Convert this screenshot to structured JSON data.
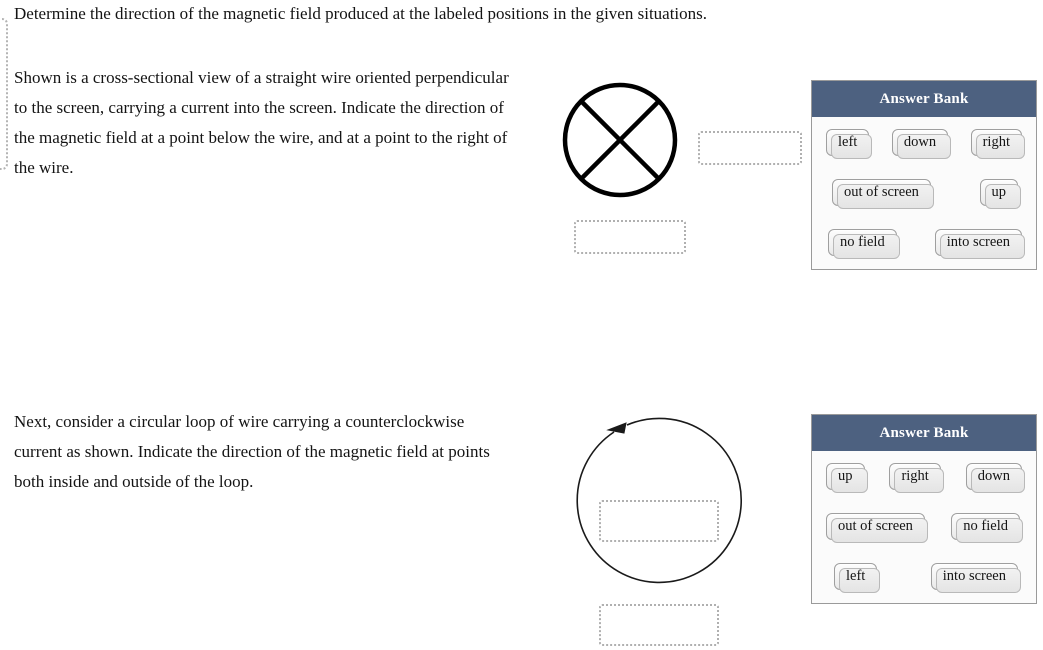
{
  "instruction": "Determine the direction of the magnetic field produced at the labeled positions in the given situations.",
  "parts": [
    {
      "id": "part-1",
      "stem": "Shown is a cross-sectional view of a straight wire oriented perpendicular to the screen, carrying a current into the screen. Indicate the direction of the magnetic field at a point below the wire, and at a point to the right of the wire.",
      "figure": {
        "type": "wire-cross-section",
        "description": "circle with an X inside indicating current into the screen",
        "dropzones": [
          {
            "name": "dropzone-right-of-wire",
            "value": ""
          },
          {
            "name": "dropzone-below-wire",
            "value": ""
          }
        ]
      },
      "answer_bank": {
        "title": "Answer Bank",
        "rows": [
          [
            "left",
            "down",
            "right"
          ],
          [
            "out of screen",
            "up"
          ],
          [
            "no field",
            "into screen"
          ]
        ]
      }
    },
    {
      "id": "part-2",
      "stem": "Next, consider a circular loop of wire carrying a counterclockwise current as shown. Indicate the direction of the magnetic field at points both inside and outside of the loop.",
      "figure": {
        "type": "current-loop",
        "description": "circle with an arrowhead at the top pointing left, indicating counterclockwise current",
        "dropzones": [
          {
            "name": "dropzone-inside-loop",
            "value": ""
          },
          {
            "name": "dropzone-outside-loop",
            "value": ""
          }
        ]
      },
      "answer_bank": {
        "title": "Answer Bank",
        "rows": [
          [
            "up",
            "right",
            "down"
          ],
          [
            "out of screen",
            "no field"
          ],
          [
            "left",
            "into screen"
          ]
        ]
      }
    }
  ],
  "colors": {
    "bank_header": "#4d6180",
    "bank_body": "#fbfbfb",
    "bank_border": "#9a9a9a",
    "dropzone_border": "#b0b0b0",
    "chip_border": "#9f9f9f",
    "diagram_stroke": "#000000",
    "text": "#141414"
  }
}
